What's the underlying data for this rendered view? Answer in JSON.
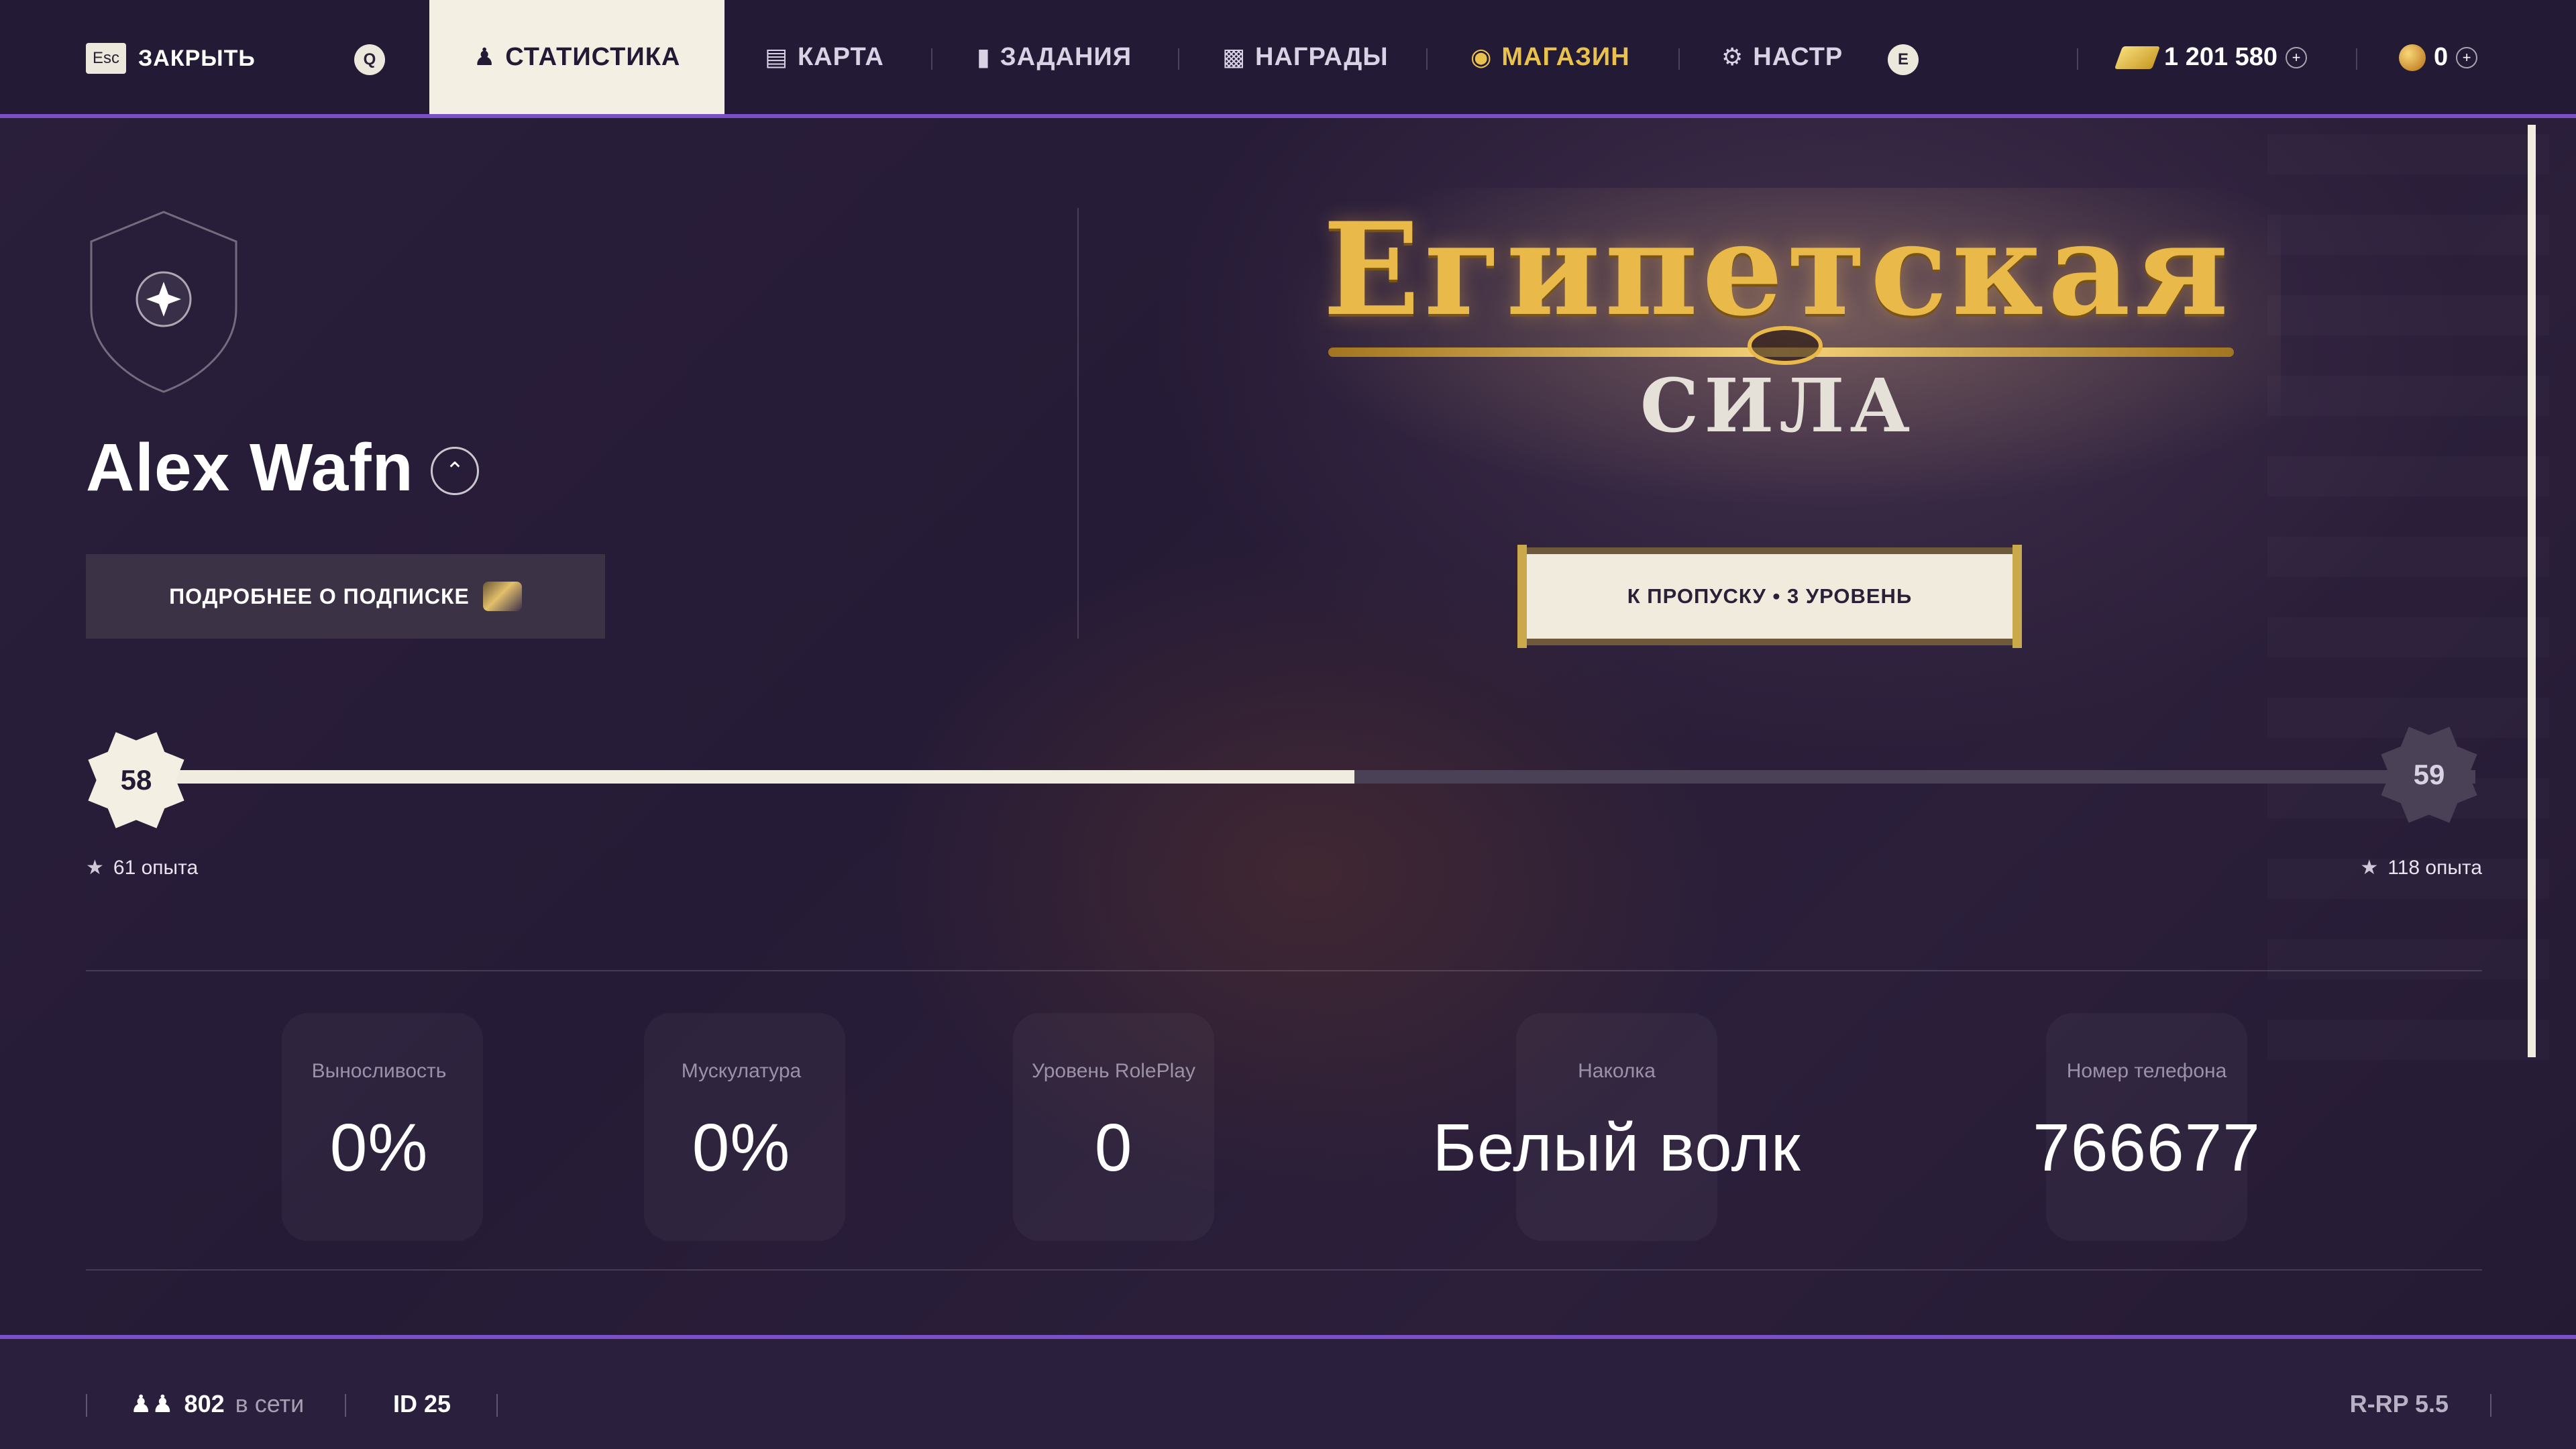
{
  "topbar": {
    "close_key": "Esc",
    "close_label": "ЗАКРЫТЬ",
    "prev_key": "Q",
    "next_key": "E",
    "tabs": [
      {
        "label": "СТАТИСТИКА",
        "icon": "person-icon",
        "active": true
      },
      {
        "label": "КАРТА",
        "icon": "map-icon"
      },
      {
        "label": "ЗАДАНИЯ",
        "icon": "task-icon"
      },
      {
        "label": "НАГРАДЫ",
        "icon": "gift-icon"
      },
      {
        "label": "МАГАЗИН",
        "icon": "coins-icon",
        "color": "#e9c14c"
      },
      {
        "label": "НАСТР",
        "icon": "gear-icon"
      }
    ],
    "money": "1 201 580",
    "coins": "0"
  },
  "profile": {
    "name": "Alex Wafn",
    "subscription_button": "ПОДРОБНЕЕ О ПОДПИСКЕ"
  },
  "event": {
    "title": "Египетская",
    "subtitle": "СИЛА",
    "pass_button": "К ПРОПУСКУ • 3 УРОВЕНЬ"
  },
  "progress": {
    "current_level": "58",
    "next_level": "59",
    "current_xp_label": "61 опыта",
    "required_xp_label": "118 опыта",
    "fraction": 0.517
  },
  "stats": [
    {
      "label": "Выносливость",
      "value": "0%"
    },
    {
      "label": "Мускулатура",
      "value": "0%"
    },
    {
      "label": "Уровень RolePlay",
      "value": "0"
    },
    {
      "label": "Наколка",
      "value": "Белый волк"
    },
    {
      "label": "Номер телефона",
      "value": "766677"
    }
  ],
  "footer": {
    "online_count": "802",
    "online_label": "в сети",
    "player_id": "ID 25",
    "version": "R-RP 5.5"
  },
  "colors": {
    "accent": "#7b4fc7",
    "background": "#2a1f3b",
    "active_tab": "#f3efe2",
    "gold": "#e9c14c"
  }
}
